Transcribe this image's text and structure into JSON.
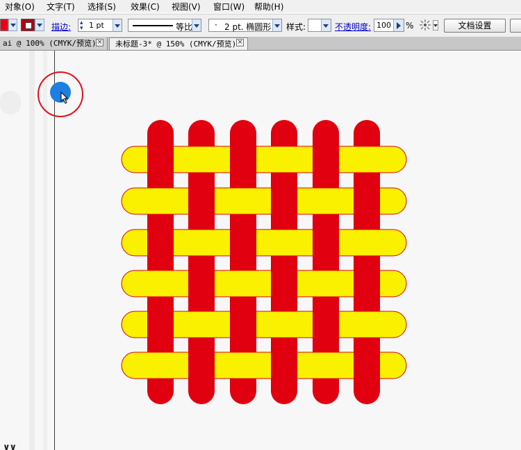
{
  "menu": [
    "对象(O)",
    "文字(T)",
    "选择(S)",
    "效果(C)",
    "视图(V)",
    "窗口(W)",
    "帮助(H)"
  ],
  "toolbar": {
    "stroke_label": "描边:",
    "stroke_weight": "1 pt",
    "stroke_profile": "等比",
    "brush": "2 pt. 椭圆形",
    "style_label": "样式:",
    "opacity_label": "不透明度:",
    "opacity_value": "100",
    "opacity_unit": "%",
    "doc_setup_button": "文档设置",
    "fill_color": "#ea0015",
    "stroke_color": "#b50010"
  },
  "tabs": [
    {
      "label": "ai @ 100% (CMYK/预览)",
      "active": false
    },
    {
      "label": "未标题-3* @ 150% (CMYK/预览)",
      "active": true
    }
  ],
  "artwork": {
    "red": "#e1000f",
    "yellow": "#f9f100",
    "outline": "#e1000f",
    "weave_pattern": [
      [
        "over",
        "under",
        "over",
        "under",
        "over",
        "under"
      ],
      [
        "under",
        "over",
        "under",
        "over",
        "under",
        "over"
      ],
      [
        "over",
        "under",
        "over",
        "under",
        "over",
        "under"
      ],
      [
        "under",
        "over",
        "under",
        "over",
        "under",
        "over"
      ],
      [
        "over",
        "under",
        "over",
        "under",
        "over",
        "under"
      ],
      [
        "under",
        "over",
        "under",
        "over",
        "under",
        "over"
      ]
    ]
  },
  "cursor": {
    "highlight_color": "#e0101a",
    "dot_color": "#1e7fe0"
  }
}
